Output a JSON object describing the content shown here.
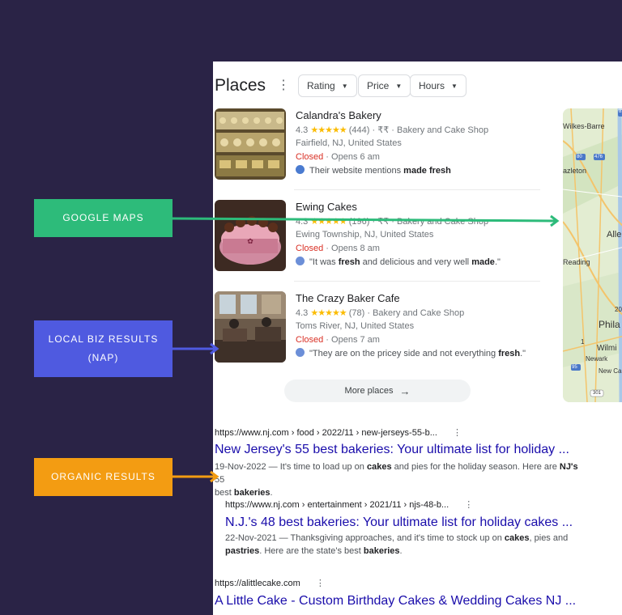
{
  "places": {
    "title": "Places",
    "filters": [
      {
        "label": "Rating"
      },
      {
        "label": "Price"
      },
      {
        "label": "Hours"
      }
    ],
    "listings": [
      {
        "name": "Calandra's Bakery",
        "rating": "4.3",
        "stars": "★★★★★",
        "reviews": "(444)",
        "price": "₹₹",
        "category": "Bakery and Cake Shop",
        "location": "Fairfield, NJ, United States",
        "status": "Closed",
        "opens": "Opens 6 am",
        "note_pre": "Their website mentions ",
        "note_bold": "made fresh",
        "note_post": ""
      },
      {
        "name": "Ewing Cakes",
        "rating": "4.3",
        "stars": "★★★★★",
        "reviews": "(196)",
        "price": "₹₹",
        "category": "Bakery and Cake Shop",
        "location": "Ewing Township, NJ, United States",
        "status": "Closed",
        "opens": "Opens 8 am",
        "note_pre": "\"It was ",
        "note_bold": "fresh",
        "note_mid": " and delicious and very well ",
        "note_bold2": "made",
        "note_post": ".\""
      },
      {
        "name": "The Crazy Baker Cafe",
        "rating": "4.3",
        "stars": "★★★★★",
        "reviews": "(78)",
        "category": "Bakery and Cake Shop",
        "location": "Toms River, NJ, United States",
        "status": "Closed",
        "opens": "Opens 7 am",
        "note_pre": "\"They are on the pricey side and not everything ",
        "note_bold": "fresh",
        "note_post": ".\""
      }
    ],
    "more_label": "More places",
    "map_labels": [
      "Wilkes-Barre",
      "azleton",
      "Alle",
      "Reading",
      "Phila",
      "Wilmi",
      "Newark",
      "New Ca",
      "81",
      "80",
      "476",
      "95",
      "1",
      "301",
      "20"
    ]
  },
  "organic": [
    {
      "url": "https://www.nj.com › food › 2022/11 › new-jerseys-55-b...",
      "title": "New Jersey's 55 best bakeries: Your ultimate list for holiday ...",
      "snippet_a": "19-Nov-2022 — It's time to load up on ",
      "snippet_b1": "cakes",
      "snippet_c": " and pies for the holiday season. Here are ",
      "snippet_b2": "NJ's",
      "snippet_d": " 55",
      "snippet_e": "best ",
      "snippet_b3": "bakeries",
      "snippet_f": "."
    },
    {
      "url": "https://www.nj.com › entertainment › 2021/11 › njs-48-b...",
      "title": "N.J.'s 48 best bakeries: Your ultimate list for holiday cakes ...",
      "snippet_a": "22-Nov-2021 — Thanksgiving approaches, and it's time to stock up on ",
      "snippet_b1": "cakes",
      "snippet_c": ", pies and",
      "snippet_b2": "pastries",
      "snippet_d": ". Here are the state's best ",
      "snippet_b3": "bakeries",
      "snippet_e": "."
    },
    {
      "url": "https://alittlecake.com",
      "title": "A Little Cake - Custom Birthday Cakes & Wedding Cakes NJ ..."
    }
  ],
  "annotations": [
    {
      "label": "GOOGLE MAPS",
      "color": "#2dbb7a"
    },
    {
      "label": "LOCAL BIZ RESULTS (NAP)",
      "color": "#4f5ae0"
    },
    {
      "label": "ORGANIC RESULTS",
      "color": "#f39c12"
    }
  ],
  "colors": {
    "background": "#2a2346",
    "link": "#1a0dab",
    "closed": "#d93025",
    "stars": "#fbbc04"
  }
}
